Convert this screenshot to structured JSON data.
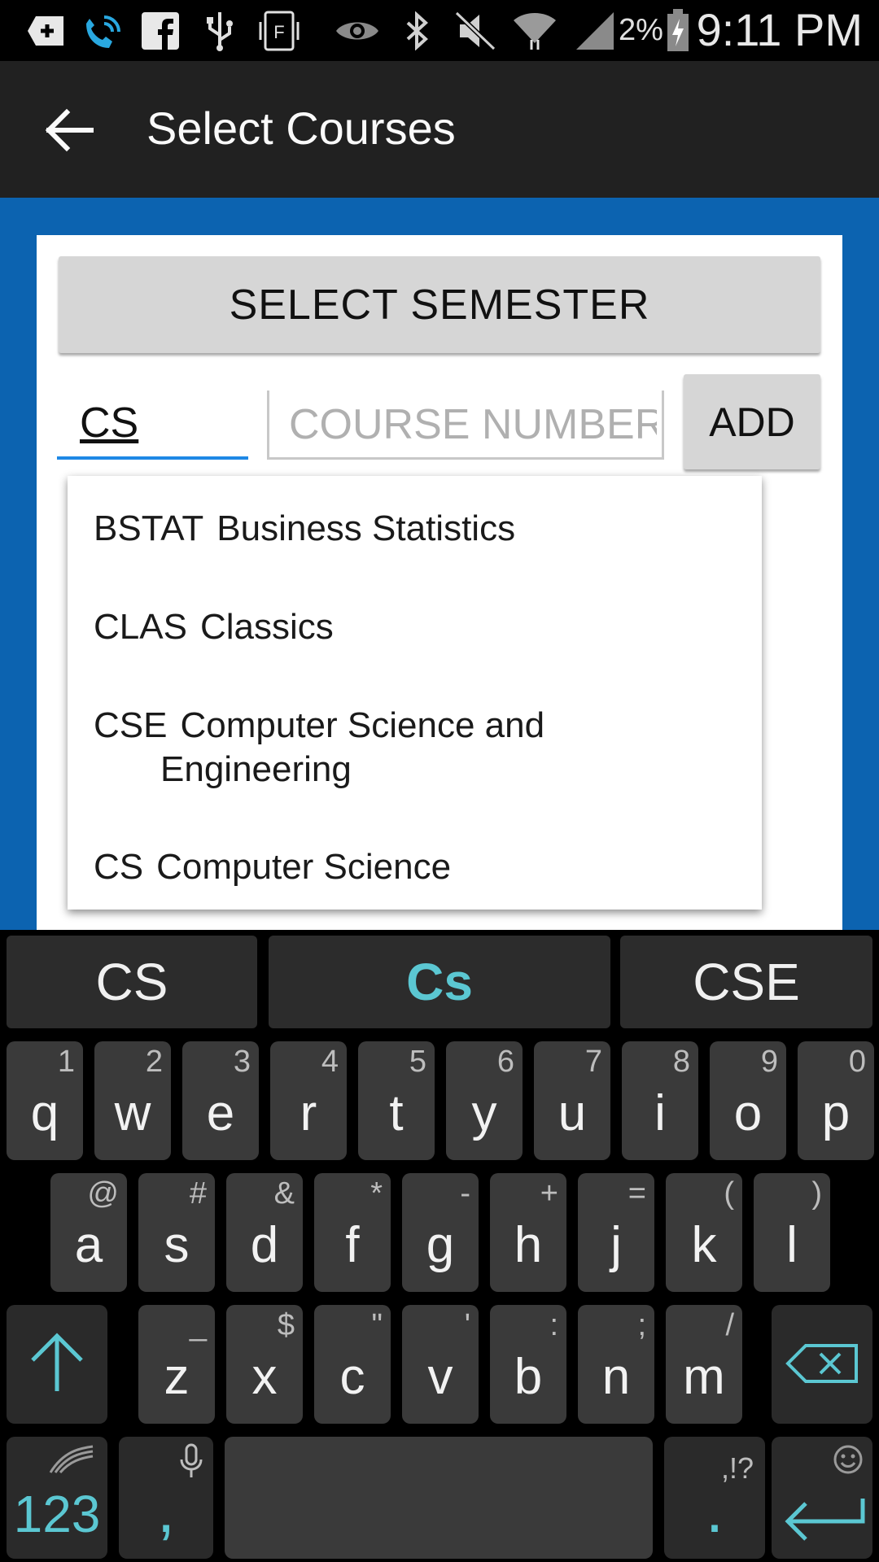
{
  "status_bar": {
    "icons": [
      "add-box-icon",
      "wifi-calling-icon",
      "facebook-icon",
      "usb-icon",
      "nfc-icon",
      "eye-icon",
      "bluetooth-icon",
      "mute-icon",
      "wifi-icon",
      "signal-icon",
      "battery-charging-icon"
    ],
    "battery_percent": "2%",
    "time": "9:11 PM"
  },
  "app_bar": {
    "back_icon": "arrow-back-icon",
    "title": "Select Courses"
  },
  "form": {
    "semester_button": "SELECT SEMESTER",
    "department_value": "CS",
    "course_number_placeholder": "COURSE NUMBER",
    "add_button": "ADD"
  },
  "dropdown": {
    "items": [
      {
        "code": "BSTAT",
        "name": "Business Statistics"
      },
      {
        "code": "CLAS",
        "name": "Classics"
      },
      {
        "code": "CSE",
        "name": "Computer Science and",
        "name_cont": "Engineering"
      },
      {
        "code": "CS",
        "name": "Computer Science"
      }
    ]
  },
  "keyboard": {
    "suggestions": [
      "CS",
      "Cs",
      "CSE"
    ],
    "row1": [
      {
        "main": "q",
        "alt": "1"
      },
      {
        "main": "w",
        "alt": "2"
      },
      {
        "main": "e",
        "alt": "3"
      },
      {
        "main": "r",
        "alt": "4"
      },
      {
        "main": "t",
        "alt": "5"
      },
      {
        "main": "y",
        "alt": "6"
      },
      {
        "main": "u",
        "alt": "7"
      },
      {
        "main": "i",
        "alt": "8"
      },
      {
        "main": "o",
        "alt": "9"
      },
      {
        "main": "p",
        "alt": "0"
      }
    ],
    "row2": [
      {
        "main": "a",
        "alt": "@"
      },
      {
        "main": "s",
        "alt": "#"
      },
      {
        "main": "d",
        "alt": "&"
      },
      {
        "main": "f",
        "alt": "*"
      },
      {
        "main": "g",
        "alt": "-"
      },
      {
        "main": "h",
        "alt": "+"
      },
      {
        "main": "j",
        "alt": "="
      },
      {
        "main": "k",
        "alt": "("
      },
      {
        "main": "l",
        "alt": ")"
      }
    ],
    "row3": [
      {
        "main": "z",
        "alt": "_"
      },
      {
        "main": "x",
        "alt": "$"
      },
      {
        "main": "c",
        "alt": "\""
      },
      {
        "main": "v",
        "alt": "'"
      },
      {
        "main": "b",
        "alt": ":"
      },
      {
        "main": "n",
        "alt": ";"
      },
      {
        "main": "m",
        "alt": "/"
      }
    ],
    "numbers_key": "123",
    "comma_key": ",",
    "period_key": ".",
    "period_alt": ",!?",
    "accent_color": "#5bc7d2"
  }
}
